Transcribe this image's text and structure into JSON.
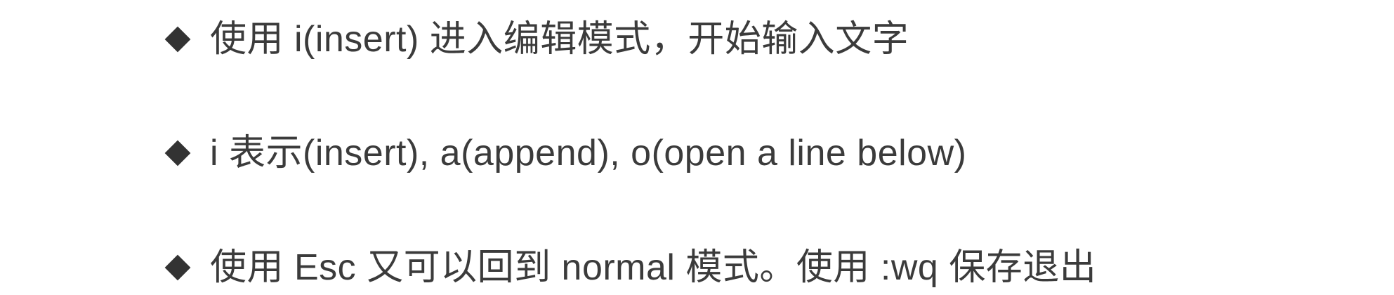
{
  "bullets": [
    {
      "text": "使用 i(insert) 进入编辑模式，开始输入文字"
    },
    {
      "text": "i 表示(insert), a(append), o(open a line below)"
    },
    {
      "text": "使用 Esc 又可以回到 normal 模式。使用 :wq 保存退出"
    }
  ],
  "icons": {
    "bullet_marker": "diamond-bullet-icon"
  },
  "colors": {
    "text": "#3b3b3b",
    "bullet": "#333333",
    "background": "#ffffff"
  }
}
